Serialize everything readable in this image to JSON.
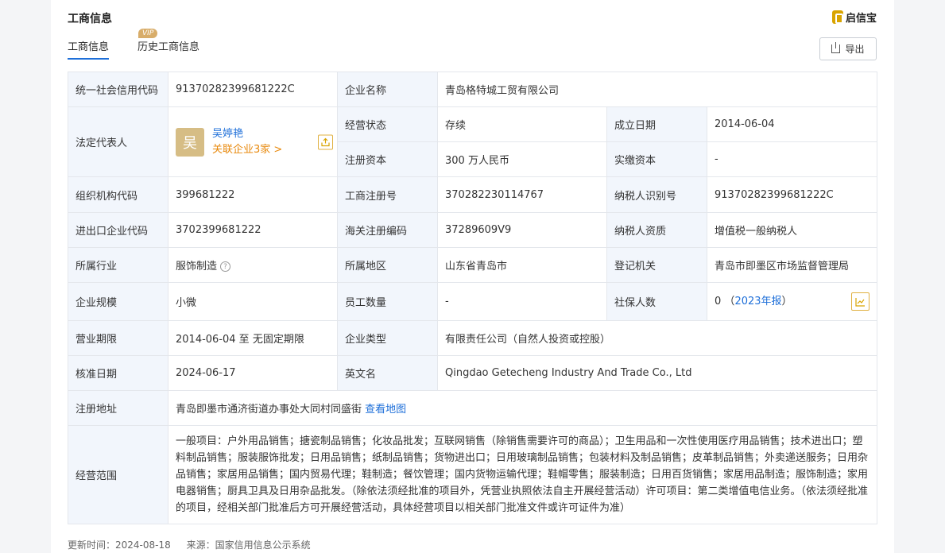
{
  "header": {
    "title": "工商信息",
    "logo_text": "启信宝"
  },
  "tabs": [
    {
      "label": "工商信息"
    },
    {
      "label": "历史工商信息",
      "badge": "VIP"
    }
  ],
  "export_label": "导出",
  "rows": {
    "credit_code_label": "统一社会信用代码",
    "credit_code": "91370282399681222C",
    "company_name_label": "企业名称",
    "company_name": "青岛格特城工贸有限公司",
    "legal_rep_label": "法定代表人",
    "legal_rep_avatar": "吴",
    "legal_rep_name": "吴婷艳",
    "legal_rep_related": "关联企业3家 >",
    "status_label": "经营状态",
    "status": "存续",
    "founded_label": "成立日期",
    "founded": "2014-06-04",
    "reg_capital_label": "注册资本",
    "reg_capital": "300 万人民币",
    "paid_capital_label": "实缴资本",
    "paid_capital": "-",
    "org_code_label": "组织机构代码",
    "org_code": "399681222",
    "reg_no_label": "工商注册号",
    "reg_no": "370282230114767",
    "taxpayer_id_label": "纳税人识别号",
    "taxpayer_id": "91370282399681222C",
    "ie_code_label": "进出口企业代码",
    "ie_code": "3702399681222",
    "customs_code_label": "海关注册编码",
    "customs_code": "37289609V9",
    "taxpayer_type_label": "纳税人资质",
    "taxpayer_type": "增值税一般纳税人",
    "industry_label": "所属行业",
    "industry": "服饰制造",
    "region_label": "所属地区",
    "region": "山东省青岛市",
    "authority_label": "登记机关",
    "authority": "青岛市即墨区市场监督管理局",
    "scale_label": "企业规模",
    "scale": "小微",
    "staff_label": "员工数量",
    "staff": "-",
    "insured_label": "社保人数",
    "insured": "0",
    "insured_report": "2023年报",
    "term_label": "营业期限",
    "term": "2014-06-04 至 无固定期限",
    "type_label": "企业类型",
    "type": "有限责任公司（自然人投资或控股）",
    "approved_label": "核准日期",
    "approved": "2024-06-17",
    "en_name_label": "英文名",
    "en_name": "Qingdao Getecheng Industry And Trade Co., Ltd",
    "address_label": "注册地址",
    "address": "青岛即墨市通济街道办事处大同村同盛街",
    "address_map": "查看地图",
    "scope_label": "经营范围",
    "scope": "一般项目：户外用品销售；搪瓷制品销售；化妆品批发；互联网销售（除销售需要许可的商品）；卫生用品和一次性使用医疗用品销售；技术进出口；塑料制品销售；服装服饰批发；日用品销售；纸制品销售；货物进出口；日用玻璃制品销售；包装材料及制品销售；皮革制品销售；外卖递送服务；日用杂品销售；家居用品销售；国内贸易代理；鞋制造；餐饮管理；国内货物运输代理；鞋帽零售；服装制造；日用百货销售；家居用品制造；服饰制造；家用电器销售；厨具卫具及日用杂品批发。（除依法须经批准的项目外，凭营业执照依法自主开展经营活动）许可项目：第二类增值电信业务。（依法须经批准的项目，经相关部门批准后方可开展经营活动，具体经营项目以相关部门批准文件或许可证件为准）"
  },
  "footer": {
    "updated": "更新时间：2024-08-18",
    "source": "来源：国家信用信息公示系统"
  }
}
